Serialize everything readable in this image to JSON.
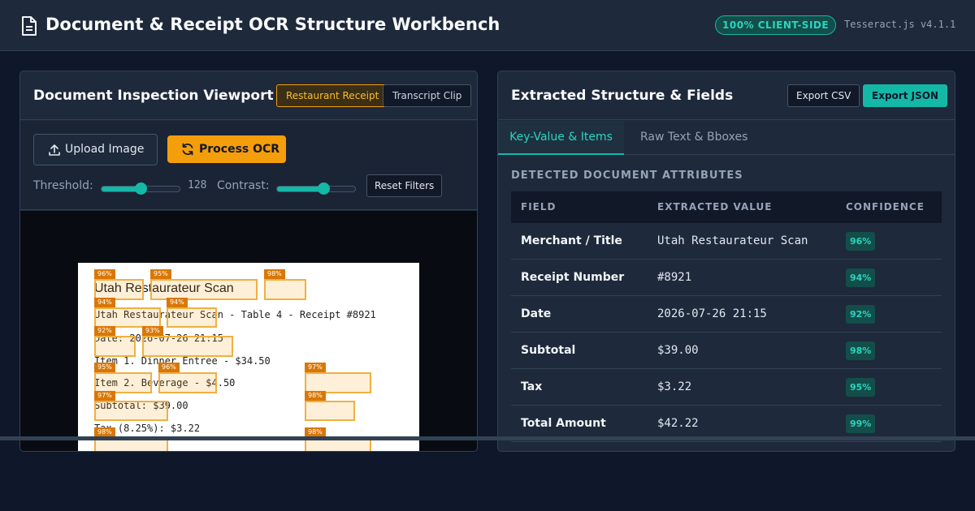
{
  "app": {
    "title": "Document & Receipt OCR Structure Workbench",
    "badge": "100% CLIENT-SIDE",
    "version": "Tesseract.js v4.1.1",
    "colors": {
      "accent": "#14b8a6",
      "warning": "#f59e0b",
      "background": "#0f172a",
      "panel": "#1e293b"
    }
  },
  "left_panel": {
    "title": "Document Inspection Viewport",
    "samples": [
      {
        "label": "Restaurant Receipt",
        "active": true
      },
      {
        "label": "Transcript Clip",
        "active": false
      }
    ],
    "upload_label": "Upload Image",
    "process_label": "Process OCR",
    "threshold": {
      "label": "Threshold:",
      "value": "128",
      "level": 0.5
    },
    "contrast": {
      "label": "Contrast:",
      "level": 0.6
    },
    "reset_label": "Reset Filters",
    "receipt": {
      "heading": "Utah Restaurateur Scan",
      "lines": [
        "Utah Restaurateur Scan - Table 4 - Receipt #8921",
        "Date: 2026-07-26 21:15",
        "Item 1. Dinner Entree - $34.50",
        "Item 2. Beverage - $4.50",
        "Subtotal: $39.00",
        "Tax (8.25%): $3.22"
      ],
      "boxes": [
        {
          "conf": "96%"
        },
        {
          "conf": "95%"
        },
        {
          "conf": "98%"
        },
        {
          "conf": "94%"
        },
        {
          "conf": "94%"
        },
        {
          "conf": "92%"
        },
        {
          "conf": "93%"
        },
        {
          "conf": "95%"
        },
        {
          "conf": "96%"
        },
        {
          "conf": "97%"
        },
        {
          "conf": "97%"
        },
        {
          "conf": "98%"
        },
        {
          "conf": "98%"
        },
        {
          "conf": "98%"
        }
      ]
    }
  },
  "right_panel": {
    "title": "Extracted Structure & Fields",
    "export_csv": "Export CSV",
    "export_json": "Export JSON",
    "tabs": [
      {
        "label": "Key-Value & Items",
        "active": true
      },
      {
        "label": "Raw Text & Bboxes",
        "active": false
      }
    ],
    "section_title": "DETECTED DOCUMENT ATTRIBUTES",
    "columns": [
      "FIELD",
      "EXTRACTED VALUE",
      "CONFIDENCE"
    ],
    "rows": [
      {
        "field": "Merchant / Title",
        "value": "Utah Restaurateur Scan",
        "confidence": "96%"
      },
      {
        "field": "Receipt Number",
        "value": "#8921",
        "confidence": "94%"
      },
      {
        "field": "Date",
        "value": "2026-07-26 21:15",
        "confidence": "92%"
      },
      {
        "field": "Subtotal",
        "value": "$39.00",
        "confidence": "98%"
      },
      {
        "field": "Tax",
        "value": "$3.22",
        "confidence": "95%"
      },
      {
        "field": "Total Amount",
        "value": "$42.22",
        "confidence": "99%"
      }
    ]
  }
}
